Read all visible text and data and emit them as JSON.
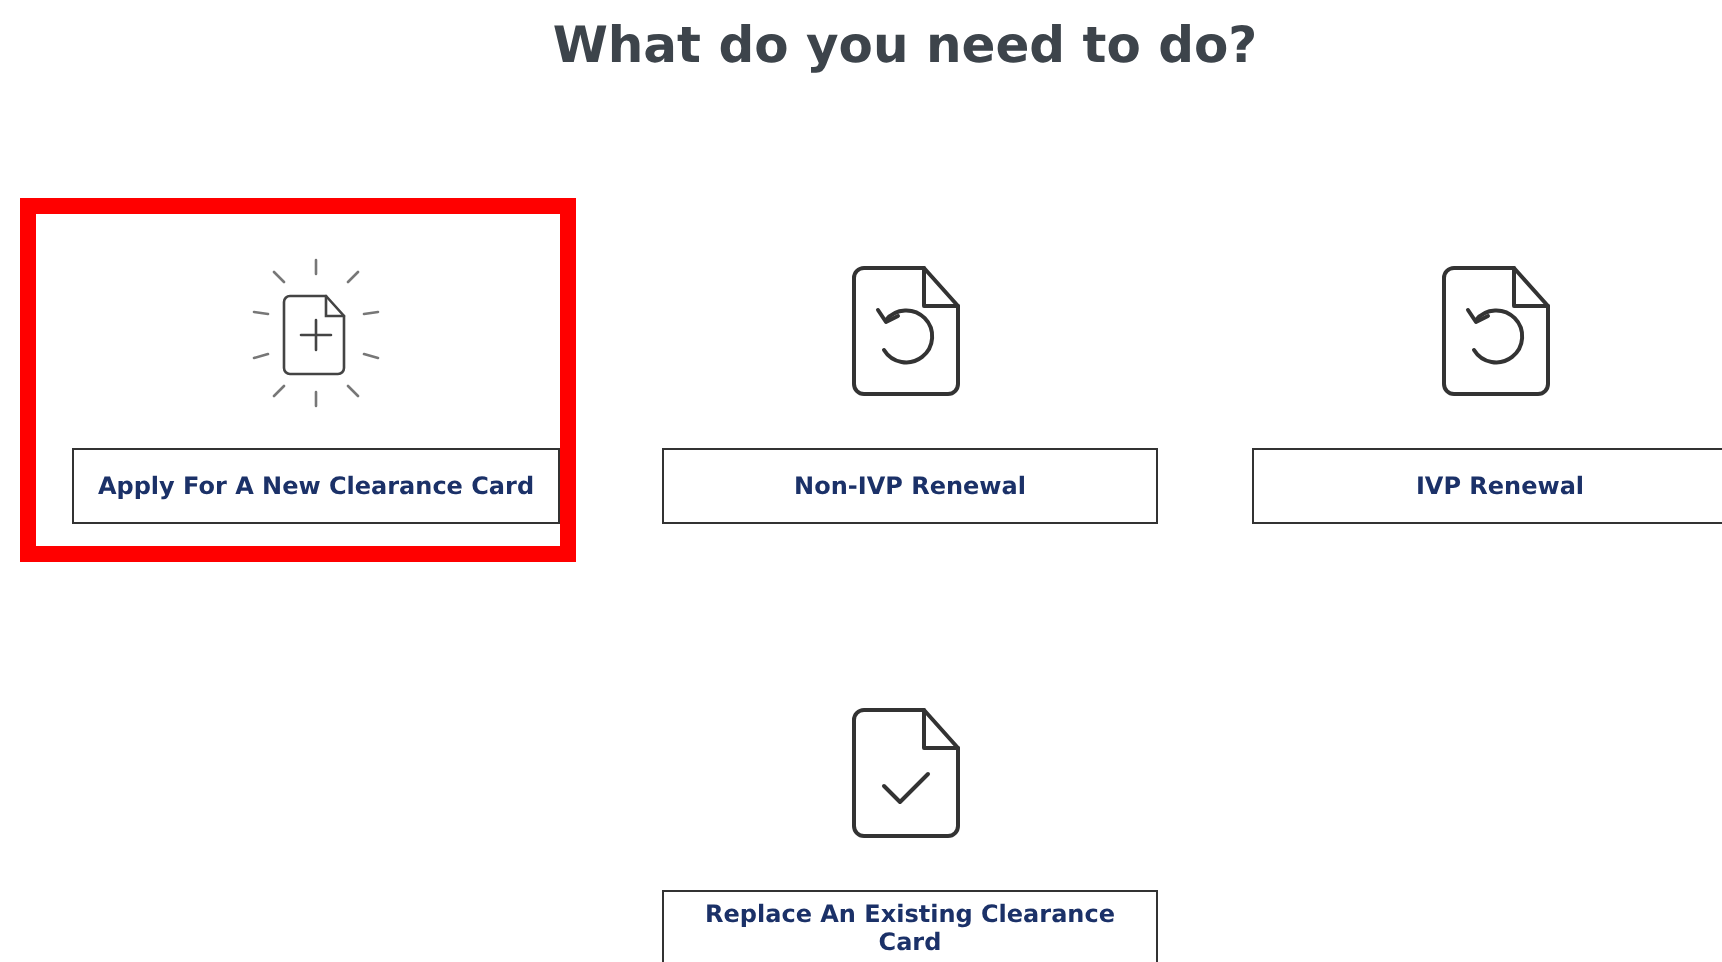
{
  "heading": "What do you need to do?",
  "options": [
    {
      "label": "Apply For A New Clearance Card",
      "kind": "new",
      "selected": true
    },
    {
      "label": "Non-IVP Renewal",
      "kind": "renew",
      "selected": false
    },
    {
      "label": "IVP Renewal",
      "kind": "renew",
      "selected": false
    },
    {
      "label": "Replace An Existing Clearance Card",
      "kind": "replace",
      "selected": false
    }
  ]
}
